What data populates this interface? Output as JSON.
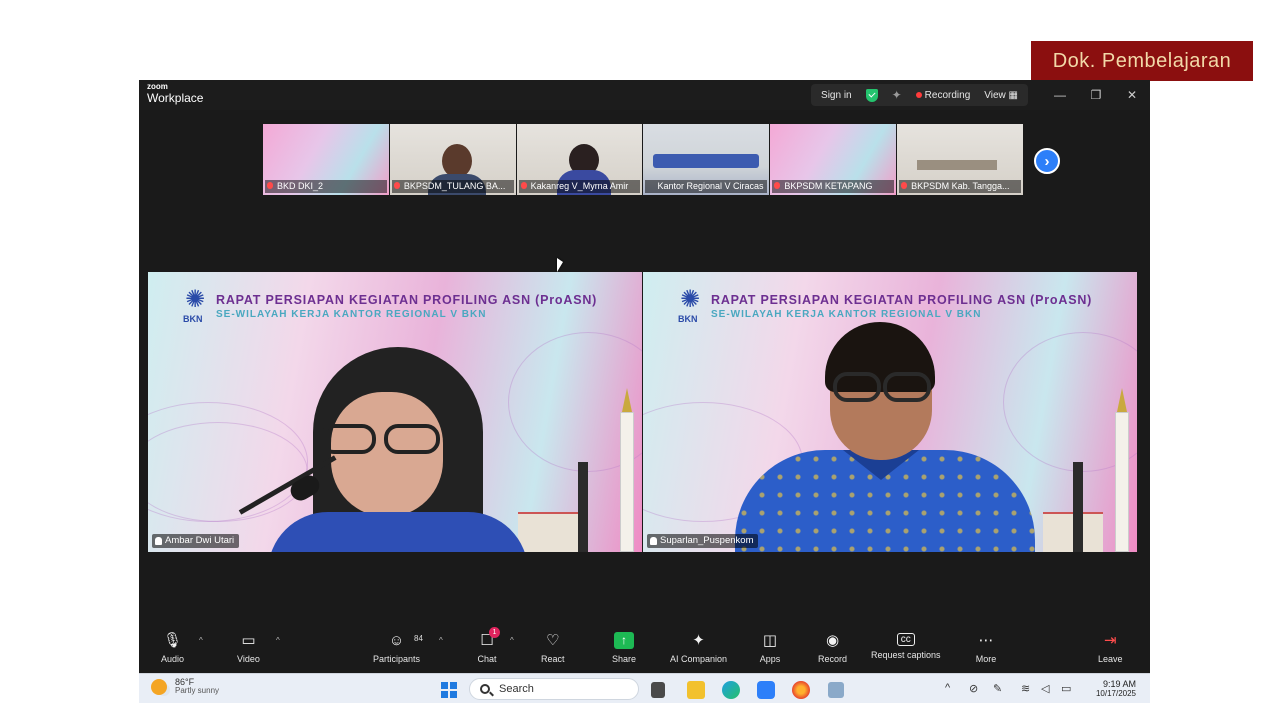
{
  "overlay": {
    "label": "Dok. Pembelajaran"
  },
  "titlebar": {
    "logo_top": "zoom",
    "logo_bottom": "Workplace",
    "sign_in": "Sign in",
    "recording": "Recording",
    "view": "View"
  },
  "thumbnails": [
    {
      "name": "BKD DKI_2"
    },
    {
      "name": "BKPSDM_TULANG BA..."
    },
    {
      "name": "Kakanreg V_Myrna Amir"
    },
    {
      "name": "Kantor Regional V Ciracas"
    },
    {
      "name": "BKPSDM KETAPANG"
    },
    {
      "name": "BKPSDM Kab. Tangga..."
    }
  ],
  "banner": {
    "title": "RAPAT PERSIAPAN KEGIATAN PROFILING ASN (ProASN)",
    "subtitle": "SE-WILAYAH KERJA KANTOR REGIONAL V BKN",
    "logo_text": "BKN"
  },
  "tiles": {
    "left_name": "Ambar Dwi Utari",
    "right_name": "Suparlan_Puspenkom"
  },
  "toolbar": {
    "audio": "Audio",
    "video": "Video",
    "participants": "Participants",
    "participants_count": "84",
    "chat": "Chat",
    "chat_badge": "1",
    "react": "React",
    "share": "Share",
    "ai_companion": "AI Companion",
    "apps": "Apps",
    "record": "Record",
    "captions": "Request captions",
    "more": "More",
    "leave": "Leave"
  },
  "taskbar": {
    "temp": "86°F",
    "weather": "Partly sunny",
    "search": "Search",
    "time": "9:19 AM",
    "date": "10/17/2025"
  },
  "colors": {
    "accent": "#2d7ff9",
    "share": "#1db954",
    "record_dot": "#ff3b3b",
    "watermark_bg": "#8b0f0f"
  }
}
